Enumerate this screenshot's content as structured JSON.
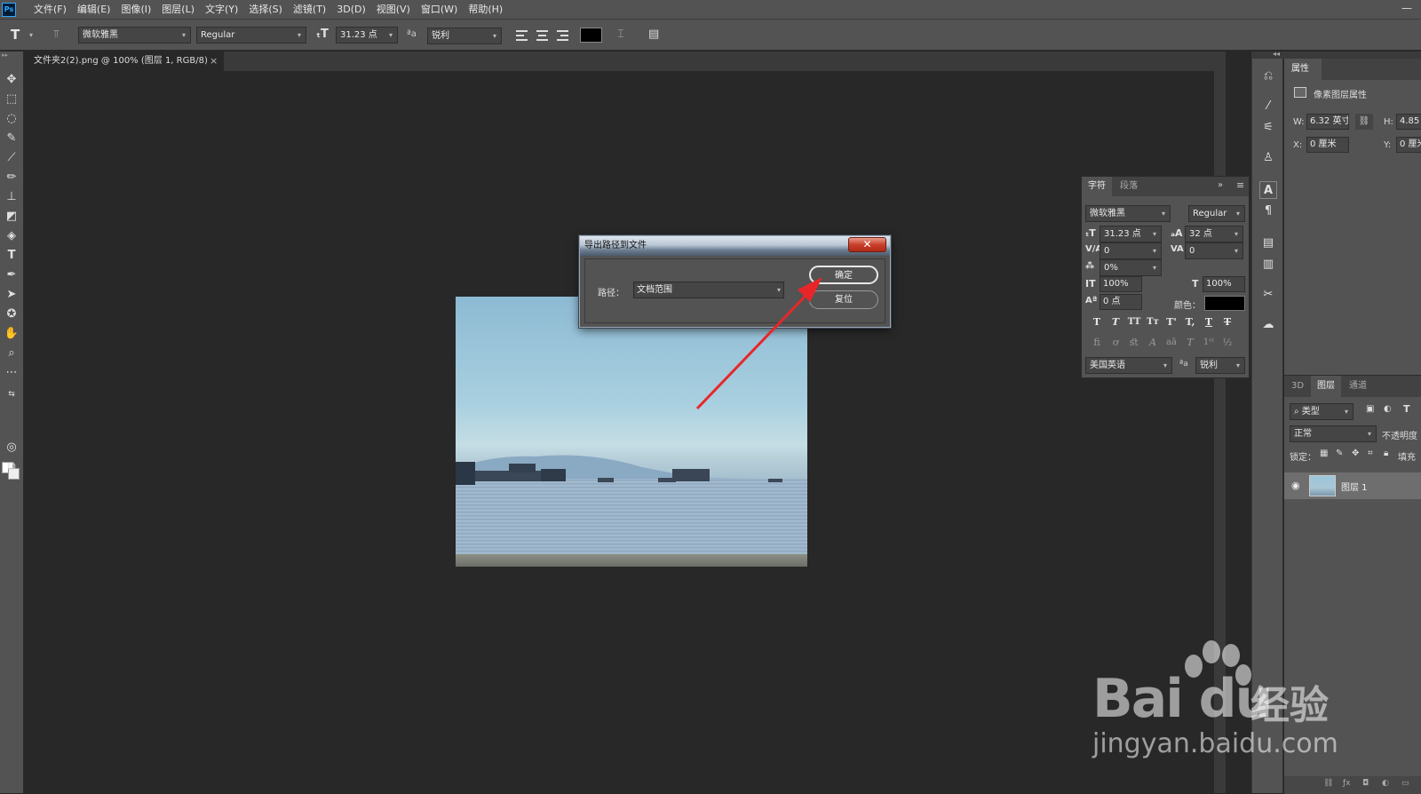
{
  "menu": {
    "app_logo": "Ps",
    "items": [
      "文件(F)",
      "编辑(E)",
      "图像(I)",
      "图层(L)",
      "文字(Y)",
      "选择(S)",
      "滤镜(T)",
      "3D(D)",
      "视图(V)",
      "窗口(W)",
      "帮助(H)"
    ],
    "minimize": "—"
  },
  "options": {
    "tool_icon": "T",
    "font_family": "微软雅黑",
    "font_style": "Regular",
    "font_size": "31.23 点",
    "antialias": "锐利",
    "text_color": "#000000"
  },
  "document": {
    "tab_title": "文件夹2(2).png @ 100% (图层 1, RGB/8)",
    "tab_close": "×"
  },
  "dialog": {
    "title": "导出路径到文件",
    "close": "✕",
    "path_label": "路径：",
    "path_value": "文档范围",
    "ok_label": "确定",
    "reset_label": "复位"
  },
  "properties": {
    "tab": "属性",
    "header": "像素图层属性",
    "w_label": "W:",
    "w_value": "6.32 英寸",
    "h_label": "H:",
    "h_value": "4.85",
    "x_label": "X:",
    "x_value": "0 厘米",
    "y_label": "Y:",
    "y_value": "0 厘米"
  },
  "character": {
    "tab_char": "字符",
    "tab_para": "段落",
    "font_family": "微软雅黑",
    "font_style": "Regular",
    "size": "31.23 点",
    "leading": "32 点",
    "kerning": "0",
    "tracking": "0",
    "tsume": "0%",
    "vscale": "100%",
    "hscale": "100%",
    "baseline": "0 点",
    "color_label": "颜色：",
    "language": "美国英语",
    "antialias": "锐利"
  },
  "layers": {
    "tabs": [
      "3D",
      "图层",
      "通道"
    ],
    "kind_filter": "类型",
    "blend_mode": "正常",
    "opacity_label": "不透明度",
    "lock_label": "锁定：",
    "fill_label": "填充",
    "layer_name": "图层 1"
  },
  "watermark": {
    "brand": "Bai du",
    "jingyan": "经验",
    "url": "jingyan.baidu.com"
  }
}
